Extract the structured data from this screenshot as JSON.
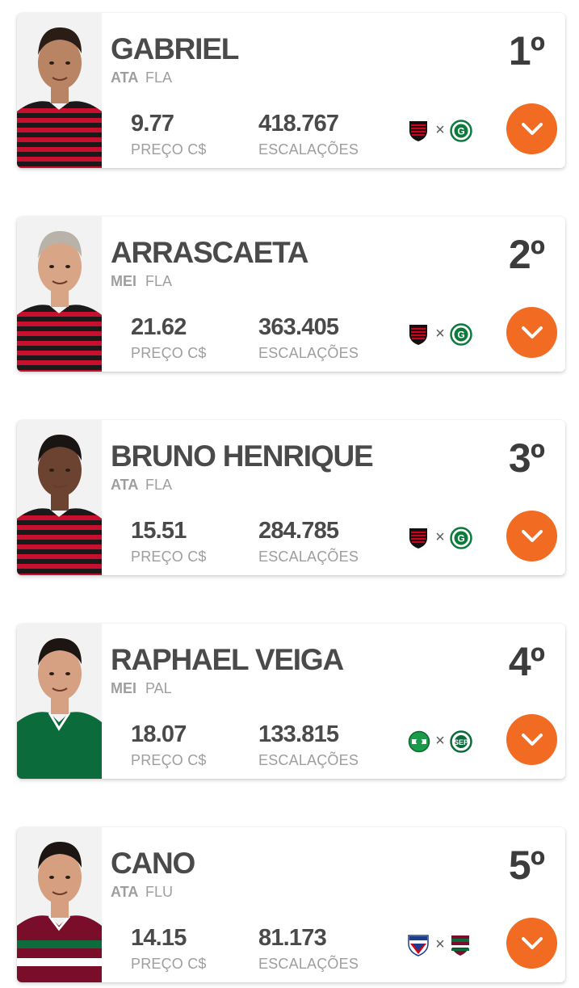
{
  "players": [
    {
      "name": "GABRIEL",
      "position": "ATA",
      "team": "FLA",
      "rank": "1º",
      "price": "9.77",
      "price_label": "PREÇO C$",
      "escalacoes": "418.767",
      "escalacoes_label": "ESCALAÇÕES",
      "home_crest": "flamengo-crest-icon",
      "vs": "×",
      "away_crest": "goias-crest-icon",
      "jersey": "flamengo",
      "skin": "#b98463",
      "hair": "#2a1d16"
    },
    {
      "name": "ARRASCAETA",
      "position": "MEI",
      "team": "FLA",
      "rank": "2º",
      "price": "21.62",
      "price_label": "PREÇO C$",
      "escalacoes": "363.405",
      "escalacoes_label": "ESCALAÇÕES",
      "home_crest": "flamengo-crest-icon",
      "vs": "×",
      "away_crest": "goias-crest-icon",
      "jersey": "flamengo",
      "skin": "#d8a586",
      "hair": "#b9b2a8"
    },
    {
      "name": "BRUNO HENRIQUE",
      "position": "ATA",
      "team": "FLA",
      "rank": "3º",
      "price": "15.51",
      "price_label": "PREÇO C$",
      "escalacoes": "284.785",
      "escalacoes_label": "ESCALAÇÕES",
      "home_crest": "flamengo-crest-icon",
      "vs": "×",
      "away_crest": "goias-crest-icon",
      "jersey": "flamengo",
      "skin": "#6b4330",
      "hair": "#1a1412"
    },
    {
      "name": "RAPHAEL VEIGA",
      "position": "MEI",
      "team": "PAL",
      "rank": "4º",
      "price": "18.07",
      "price_label": "PREÇO C$",
      "escalacoes": "133.815",
      "escalacoes_label": "ESCALAÇÕES",
      "home_crest": "juventude-crest-icon",
      "vs": "×",
      "away_crest": "palmeiras-crest-icon",
      "jersey": "palmeiras",
      "skin": "#d5a182",
      "hair": "#1c1512"
    },
    {
      "name": "CANO",
      "position": "ATA",
      "team": "FLU",
      "rank": "5º",
      "price": "14.15",
      "price_label": "PREÇO C$",
      "escalacoes": "81.173",
      "escalacoes_label": "ESCALAÇÕES",
      "home_crest": "fortaleza-crest-icon",
      "vs": "×",
      "away_crest": "fluminense-crest-icon",
      "jersey": "fluminense",
      "skin": "#d6a080",
      "hair": "#1c1512"
    }
  ],
  "colors": {
    "accent": "#f26b22",
    "name_text": "#4a4a4a",
    "muted_text": "#9e9e9e",
    "rank_text": "#3c3c3c"
  },
  "icons": {
    "expand": "chevron-down-icon"
  }
}
